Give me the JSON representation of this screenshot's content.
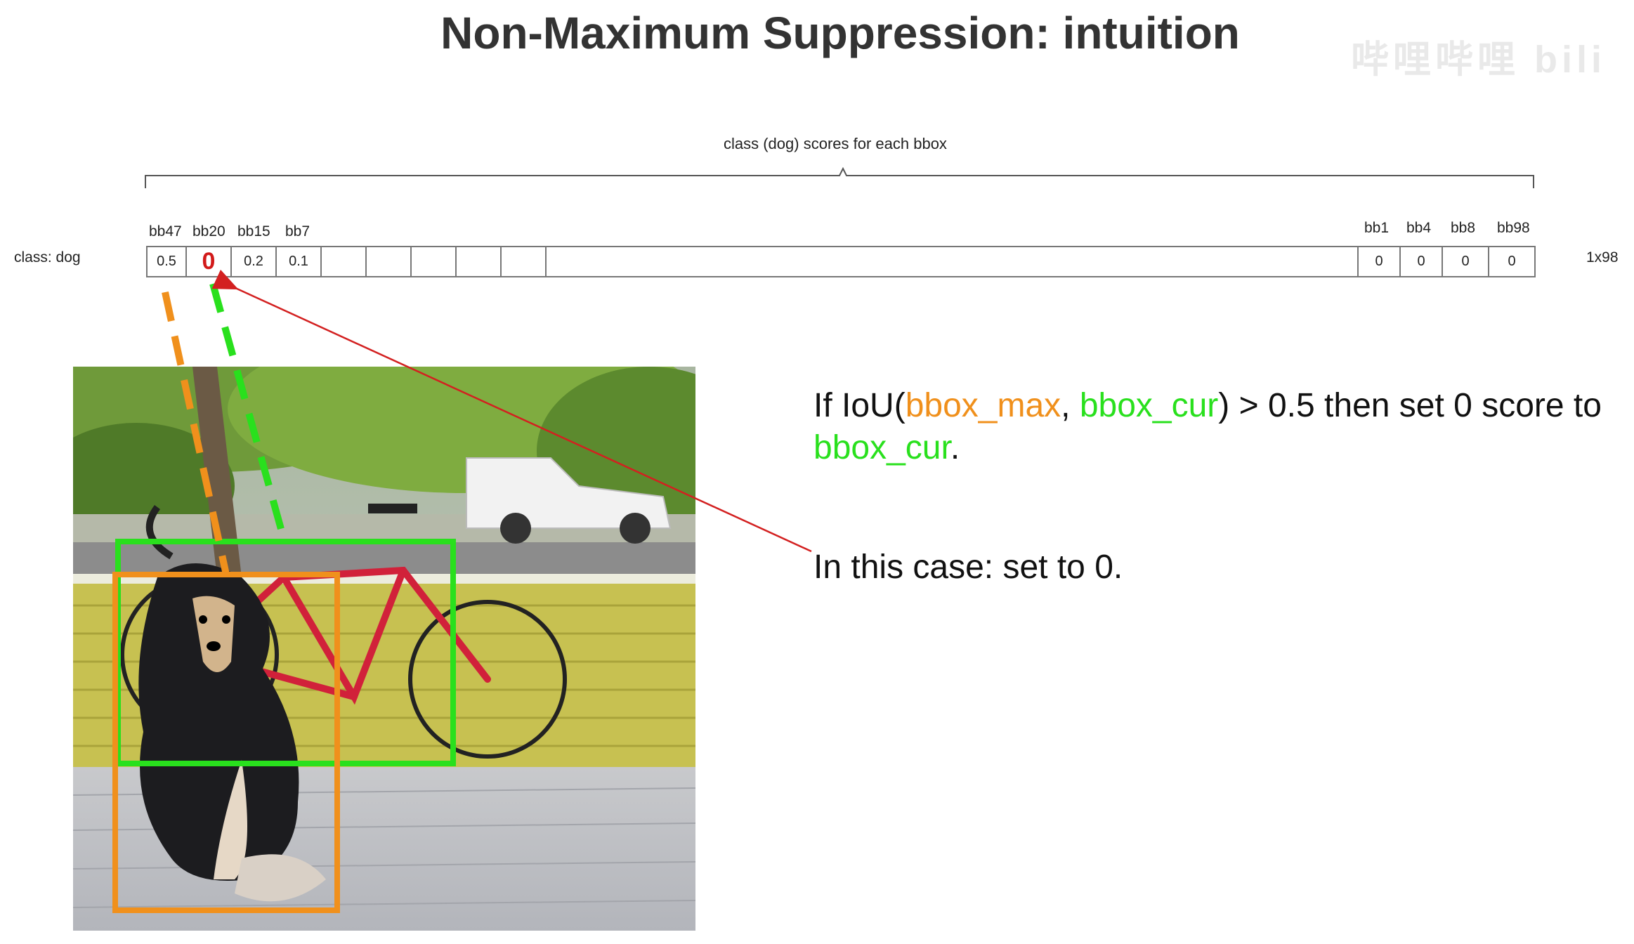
{
  "title": "Non-Maximum Suppression: intuition",
  "watermark": "哔哩哔哩 bili",
  "brace_label": "class (dog) scores for each bbox",
  "row_label": "class: dog",
  "dims": "1x98",
  "columns_left": [
    {
      "label": "bb47",
      "score": "0.5"
    },
    {
      "label": "bb20",
      "score": "0"
    },
    {
      "label": "bb15",
      "score": "0.2"
    },
    {
      "label": "bb7",
      "score": "0.1"
    }
  ],
  "columns_right": [
    {
      "label": "bb1",
      "score": "0"
    },
    {
      "label": "bb4",
      "score": "0"
    },
    {
      "label": "bb8",
      "score": "0"
    },
    {
      "label": "bb98",
      "score": "0"
    }
  ],
  "rule": {
    "prefix": "If IoU(",
    "bbox_max": "bbox_max",
    "comma": ", ",
    "bbox_cur": "bbox_cur",
    "suffix": ") > 0.5 then set 0 score to ",
    "end_target": "bbox_cur",
    "period": "."
  },
  "case_text": "In this case: set to 0.",
  "colors": {
    "bbox_max": "#f0901c",
    "bbox_cur": "#29e01d",
    "highlight_zero": "#d21a1a",
    "arrow": "#d32020"
  }
}
